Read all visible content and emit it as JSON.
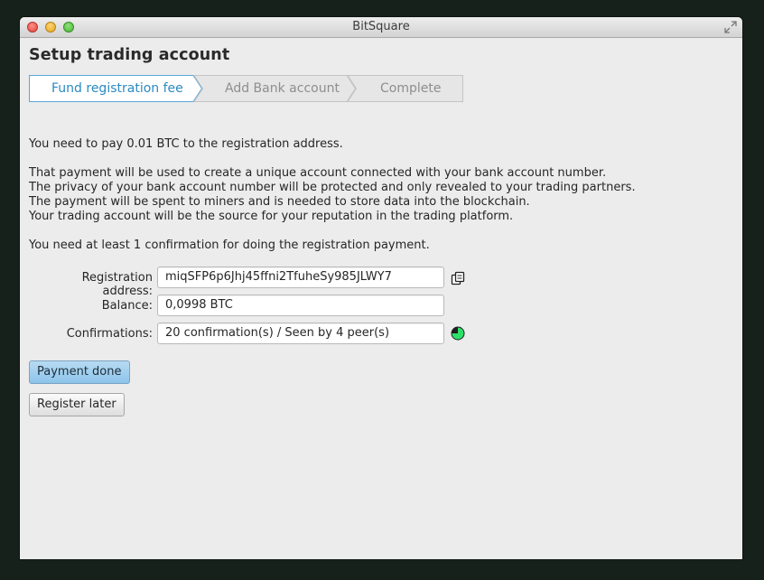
{
  "window": {
    "title": "BitSquare"
  },
  "page": {
    "title": "Setup trading account"
  },
  "steps": [
    {
      "label": "Fund registration fee",
      "active": true
    },
    {
      "label": "Add Bank account",
      "active": false
    },
    {
      "label": "Complete",
      "active": false
    }
  ],
  "info": {
    "line1": "You need to pay 0.01 BTC to the registration address.",
    "line2": "That payment will be used to create a unique account connected with your bank account number.",
    "line3": "The privacy of your bank account number will be protected and only revealed to your trading partners.",
    "line4": "The payment will be spent to miners and is needed to store data into the blockchain.",
    "line5": "Your trading account will be the source for your reputation in the trading platform.",
    "line6": "You need at least 1 confirmation for doing the registration payment."
  },
  "form": {
    "address_label": "Registration address:",
    "address_value": "miqSFP6p6Jhj45ffni2TfuheSy985JLWY7",
    "balance_label": "Balance:",
    "balance_value": "0,0998 BTC",
    "confirmations_label": "Confirmations:",
    "confirmations_value": "20 confirmation(s) / Seen by 4 peer(s)",
    "copy_icon": "copy-icon",
    "progress_icon": "confirmation-progress-icon",
    "confirmation_progress": 0.75
  },
  "buttons": {
    "payment_done": "Payment done",
    "register_later": "Register later"
  },
  "colors": {
    "accent": "#2b8ac2",
    "primary_button": "#a6d1ef",
    "progress_fill": "#2ee06a"
  }
}
